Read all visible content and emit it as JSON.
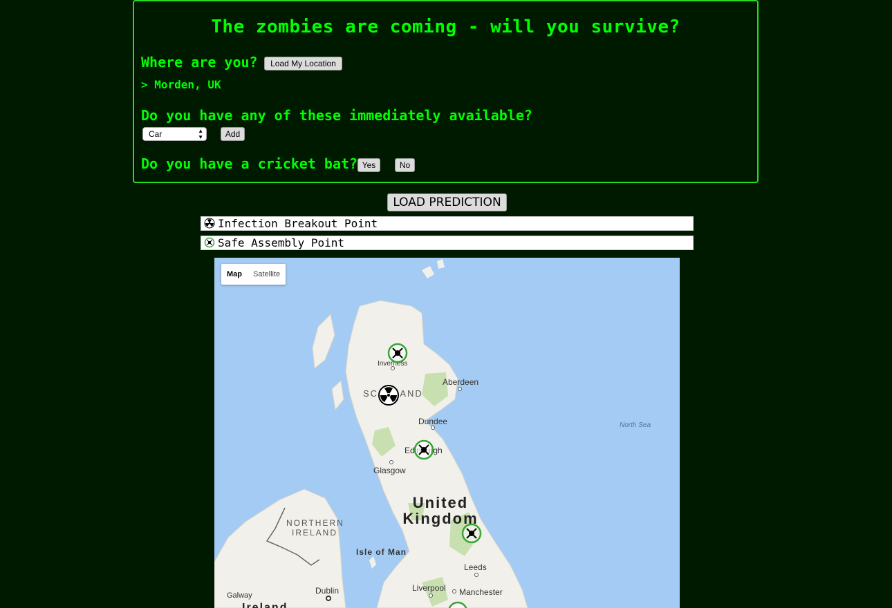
{
  "header": {
    "title": "The zombies are coming - will you survive?",
    "where_question": "Where are you?",
    "load_location_label": "Load My Location",
    "location_text": "> Morden, UK",
    "items_question": "Do you have any of these immediately available?",
    "item_select_value": "Car",
    "add_label": "Add",
    "bat_question": "Do you have a cricket bat?",
    "yes_label": "Yes",
    "no_label": "No"
  },
  "predict_label": "LOAD PREDICTION",
  "legend": {
    "infection_label": "Infection Breakout Point",
    "safe_label": "Safe Assembly Point"
  },
  "map": {
    "map_type": {
      "map_label": "Map",
      "satellite_label": "Satellite",
      "selected": "Map"
    },
    "labels": {
      "inverness": "Inverness",
      "aberdeen": "Aberdeen",
      "scotland": "SCOTLAND",
      "dundee": "Dundee",
      "north_sea": "North Sea",
      "edinburgh": "Edinburgh",
      "glasgow": "Glasgow",
      "united": "United",
      "kingdom": "Kingdom",
      "northern": "NORTHERN",
      "ireland_region": "IRELAND",
      "isle_of_man": "Isle of Man",
      "leeds": "Leeds",
      "liverpool": "Liverpool",
      "manchester": "Manchester",
      "galway": "Galway",
      "dublin": "Dublin",
      "ireland": "Ireland"
    },
    "colors": {
      "water": "#a4cbf3",
      "land": "#f2f0ea",
      "park": "#c8e0b0",
      "safe_ring": "#3aa33a"
    }
  }
}
